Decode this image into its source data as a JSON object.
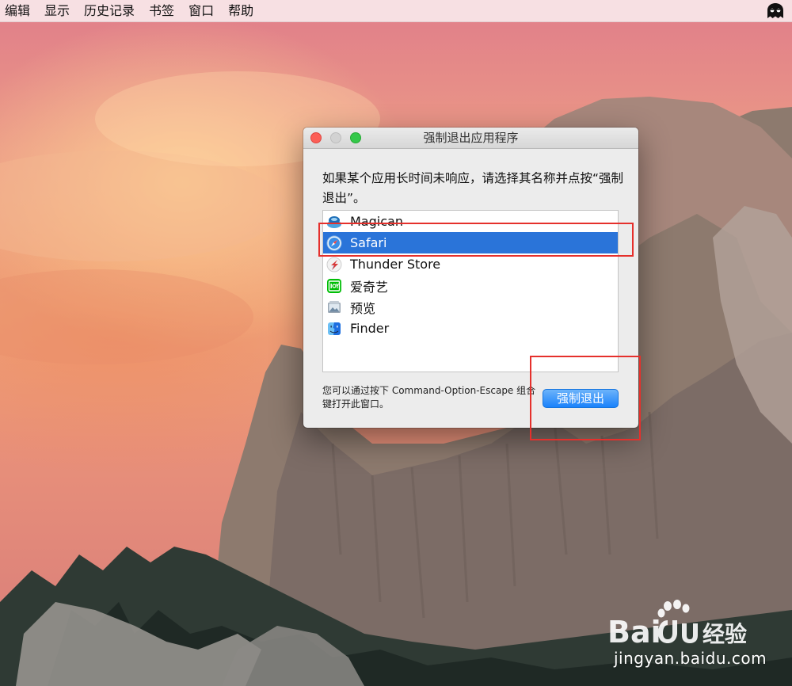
{
  "menubar": {
    "items": [
      "编辑",
      "显示",
      "历史记录",
      "书签",
      "窗口",
      "帮助"
    ],
    "status_icon": "ghost-icon"
  },
  "dialog": {
    "title": "强制退出应用程序",
    "instruction": "如果某个应用长时间未响应，请选择其名称并点按“强制退出”。",
    "apps": [
      {
        "name": "Magican",
        "icon": "magican-icon"
      },
      {
        "name": "Safari",
        "icon": "safari-icon",
        "selected": true
      },
      {
        "name": "Thunder Store",
        "icon": "thunder-store-icon"
      },
      {
        "name": "爱奇艺",
        "icon": "iqiyi-icon"
      },
      {
        "name": "预览",
        "icon": "preview-icon"
      },
      {
        "name": "Finder",
        "icon": "finder-icon"
      }
    ],
    "footer_note": "您可以通过按下 Command-Option-Escape 组合键打开此窗口。",
    "force_quit_label": "强制退出"
  },
  "colors": {
    "selection": "#2a74d9",
    "annotation": "#e5302c",
    "button": "#1a82fb"
  },
  "watermark": {
    "logo_text": "Bai du 经验",
    "url": "jingyan.baidu.com"
  }
}
